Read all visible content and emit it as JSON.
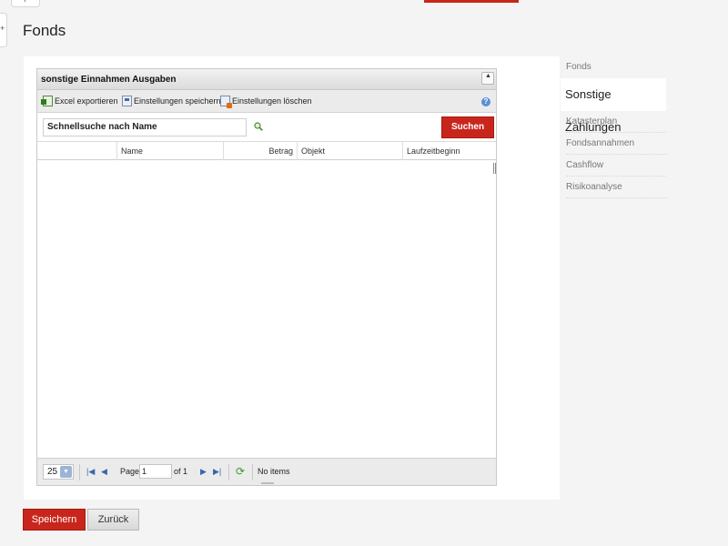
{
  "top_tab": {
    "symbol": "+"
  },
  "side_handle": {
    "symbol": "+"
  },
  "page": {
    "title": "Fonds"
  },
  "grid": {
    "title": "sonstige Einnahmen Ausgaben",
    "collapse_symbol": "▲",
    "toolbar": {
      "excel_export": "Excel exportieren",
      "save_settings": "Einstellungen speichern",
      "delete_settings": "Einstellungen löschen",
      "help_symbol": "?"
    },
    "search": {
      "value": "Schnellsuche nach Name",
      "button_label": "Suchen"
    },
    "columns": [
      "",
      "Name",
      "Betrag",
      "Objekt",
      "Laufzeitbeginn"
    ],
    "rows": [],
    "pager": {
      "page_size": "25",
      "page_label": "Page",
      "page_value": "1",
      "of_label": "of 1",
      "status": "No items",
      "first_symbol": "|◀",
      "prev_symbol": "◀",
      "next_symbol": "▶",
      "last_symbol": "▶|",
      "refresh_symbol": "⟳"
    }
  },
  "sidebar": {
    "items": [
      {
        "label": "Fonds",
        "active": false
      },
      {
        "label": "Sonstige Zahlungen",
        "active": true
      },
      {
        "label": "Katasterplan",
        "active": false
      },
      {
        "label": "Fondsannahmen",
        "active": false
      },
      {
        "label": "Cashflow",
        "active": false
      },
      {
        "label": "Risikoanalyse",
        "active": false
      }
    ]
  },
  "footer": {
    "save_label": "Speichern",
    "back_label": "Zurück"
  },
  "colors": {
    "accent": "#c8261c",
    "background": "#f4f4f4"
  }
}
